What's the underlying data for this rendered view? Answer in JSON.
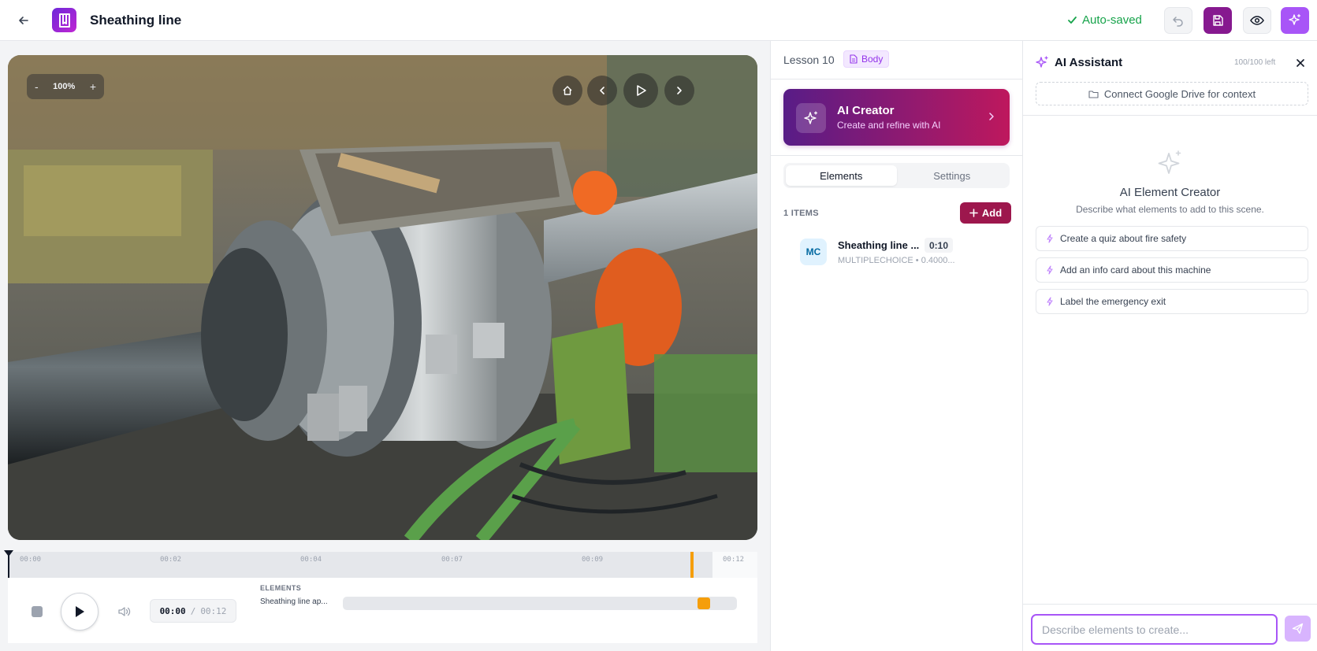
{
  "header": {
    "title": "Sheathing line",
    "status": "Auto-saved"
  },
  "viewer": {
    "zoom": "100%",
    "zoom_out": "-",
    "zoom_in": "+"
  },
  "timeline": {
    "ticks": [
      "00:00",
      "00:02",
      "00:04",
      "00:07",
      "00:09",
      "00:12"
    ],
    "current_time": "00:00",
    "separator": "/",
    "total_time": "00:12",
    "elements_heading": "ELEMENTS",
    "track_label": "Sheathing line ap...",
    "marker_position": 0.93
  },
  "lesson": {
    "label": "Lesson 10",
    "badge": "Body",
    "ai_creator": {
      "title": "AI Creator",
      "subtitle": "Create and refine with AI"
    },
    "tabs": [
      {
        "label": "Elements",
        "active": true
      },
      {
        "label": "Settings",
        "active": false
      }
    ],
    "items_count": "1 ITEMS",
    "add_label": "Add",
    "items": [
      {
        "badge": "MC",
        "title": "Sheathing line ...",
        "time": "0:10",
        "meta": "MULTIPLECHOICE • 0.4000..."
      }
    ]
  },
  "assistant": {
    "title": "AI Assistant",
    "quota": "100/100 left",
    "drive_label": "Connect Google Drive for context",
    "empty_title": "AI Element Creator",
    "empty_subtitle": "Describe what elements to add to this scene.",
    "suggestions": [
      "Create a quiz about fire safety",
      "Add an info card about this machine",
      "Label the emergency exit"
    ],
    "input_placeholder": "Describe elements to create..."
  },
  "colors": {
    "accent": "#a855f7",
    "brand": "#86198f",
    "success": "#16a34a",
    "marker": "#f59e0b"
  }
}
